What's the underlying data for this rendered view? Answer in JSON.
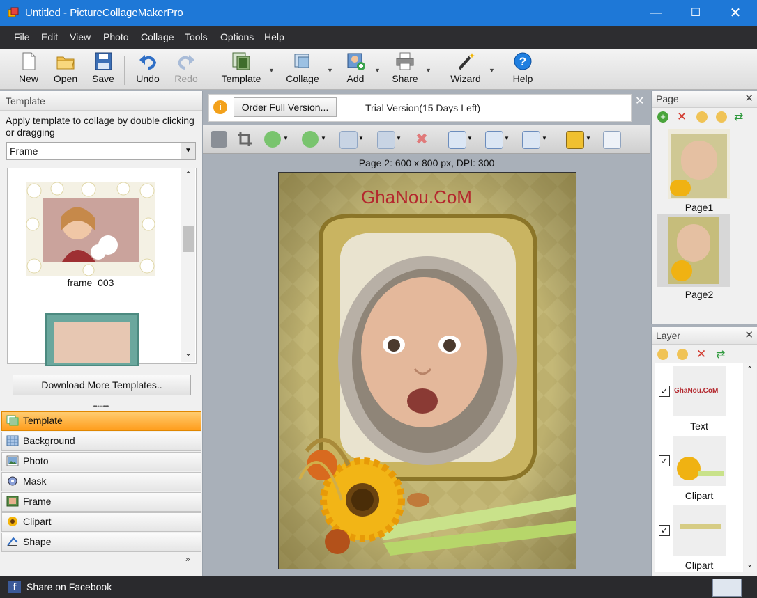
{
  "window": {
    "title": "Untitled - PictureCollageMakerPro"
  },
  "menu": [
    "File",
    "Edit",
    "View",
    "Photo",
    "Collage",
    "Tools",
    "Options",
    "Help"
  ],
  "toolbar": {
    "new": "New",
    "open": "Open",
    "save": "Save",
    "undo": "Undo",
    "redo": "Redo",
    "template": "Template",
    "collage": "Collage",
    "add": "Add",
    "share": "Share",
    "wizard": "Wizard",
    "help": "Help"
  },
  "template_panel": {
    "header": "Template",
    "instruction": "Apply template to collage by double clicking or dragging",
    "category": "Frame",
    "items": [
      {
        "name": "frame_003"
      }
    ],
    "download_button": "Download More Templates.."
  },
  "left_nav": [
    {
      "label": "Template",
      "active": true
    },
    {
      "label": "Background",
      "active": false
    },
    {
      "label": "Photo",
      "active": false
    },
    {
      "label": "Mask",
      "active": false
    },
    {
      "label": "Frame",
      "active": false
    },
    {
      "label": "Clipart",
      "active": false
    },
    {
      "label": "Shape",
      "active": false
    }
  ],
  "trial": {
    "button": "Order Full Version...",
    "text": "Trial Version(15 Days Left)"
  },
  "canvas": {
    "info": "Page 2: 600 x 800 px, DPI: 300",
    "text_layer": "GhaNou.CoM"
  },
  "page_panel": {
    "header": "Page",
    "pages": [
      "Page1",
      "Page2"
    ],
    "selected": "Page2"
  },
  "layer_panel": {
    "header": "Layer",
    "layers": [
      {
        "label": "Text",
        "preview_text": "GhaNou.CoM",
        "checked": true
      },
      {
        "label": "Clipart",
        "checked": true
      },
      {
        "label": "Clipart",
        "checked": true
      }
    ]
  },
  "status": {
    "share": "Share on Facebook"
  },
  "colors": {
    "titlebar": "#1e78d7",
    "menubar": "#2d2d30",
    "active_nav": "#ff9d1c",
    "workspace": "#a9b0b9",
    "text_layer": "#b4282e"
  }
}
